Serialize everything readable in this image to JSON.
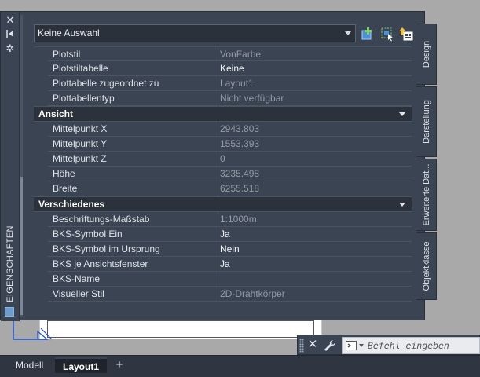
{
  "palette": {
    "side_title": "EIGENSCHAFTEN",
    "selection": "Keine Auswahl",
    "toolbar_icons": [
      "toggle-pickadd-icon",
      "select-objects-icon",
      "quick-select-icon"
    ],
    "groups": [
      {
        "title": "",
        "rows": [
          {
            "label": "Plotstil",
            "value": "VonFarbe",
            "editable": false
          },
          {
            "label": "Plotstiltabelle",
            "value": "Keine",
            "editable": true
          },
          {
            "label": "Plottabelle zugeordnet zu",
            "value": "Layout1",
            "editable": false
          },
          {
            "label": "Plottabellentyp",
            "value": "Nicht verfügbar",
            "editable": false
          }
        ]
      },
      {
        "title": "Ansicht",
        "rows": [
          {
            "label": "Mittelpunkt X",
            "value": "2943.803",
            "editable": false
          },
          {
            "label": "Mittelpunkt Y",
            "value": "1553.393",
            "editable": false
          },
          {
            "label": "Mittelpunkt Z",
            "value": "0",
            "editable": false
          },
          {
            "label": "Höhe",
            "value": "3235.498",
            "editable": false
          },
          {
            "label": "Breite",
            "value": "6255.518",
            "editable": false
          }
        ]
      },
      {
        "title": "Verschiedenes",
        "rows": [
          {
            "label": "Beschriftungs-Maßstab",
            "value": "1:1000m",
            "editable": false
          },
          {
            "label": "BKS-Symbol Ein",
            "value": "Ja",
            "editable": true
          },
          {
            "label": "BKS-Symbol im Ursprung",
            "value": "Nein",
            "editable": true
          },
          {
            "label": "BKS je Ansichtsfenster",
            "value": "Ja",
            "editable": true
          },
          {
            "label": "BKS-Name",
            "value": "",
            "editable": true
          },
          {
            "label": "Visueller Stil",
            "value": "2D-Drahtkörper",
            "editable": false
          }
        ]
      }
    ],
    "tabs": [
      {
        "label": "Design",
        "active": true
      },
      {
        "label": "Darstellung",
        "active": false
      },
      {
        "label": "Erweiterte Dat...",
        "active": false
      },
      {
        "label": "Objektklasse",
        "active": false
      }
    ]
  },
  "command_line": {
    "placeholder": "Befehl eingeben"
  },
  "layout_tabs": {
    "items": [
      {
        "label": "Modell",
        "active": false
      },
      {
        "label": "Layout1",
        "active": true
      }
    ],
    "add_label": "+"
  },
  "colors": {
    "panel": "#3b4452",
    "category": "#2c323c",
    "readonly_text": "#949ba6",
    "editable_text": "#f2f4f7"
  }
}
